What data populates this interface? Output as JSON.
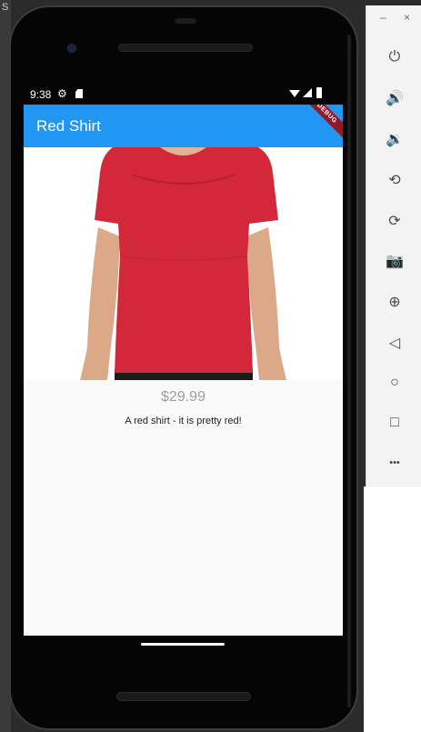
{
  "host": {
    "edge_label": "S"
  },
  "status_bar": {
    "time": "9:38"
  },
  "app": {
    "title": "Red Shirt",
    "debug_banner": "DEBUG",
    "accent": "#2196f3",
    "product": {
      "image_alt": "red-shirt-photo",
      "shirt_color": "#d3283a",
      "price": "$29.99",
      "description": "A red shirt - it is pretty red!"
    }
  },
  "emulator_toolbar": {
    "minimize": "–",
    "close": "×",
    "buttons": [
      {
        "name": "power-icon",
        "glyph": "⏻"
      },
      {
        "name": "volume-up-icon",
        "glyph": "🔊"
      },
      {
        "name": "volume-down-icon",
        "glyph": "🔉"
      },
      {
        "name": "rotate-left-icon",
        "glyph": "⟲"
      },
      {
        "name": "rotate-right-icon",
        "glyph": "⟳"
      },
      {
        "name": "camera-icon",
        "glyph": "📷"
      },
      {
        "name": "zoom-icon",
        "glyph": "⊕"
      },
      {
        "name": "back-icon",
        "glyph": "◁"
      },
      {
        "name": "home-icon",
        "glyph": "○"
      },
      {
        "name": "overview-icon",
        "glyph": "□"
      },
      {
        "name": "more-icon",
        "glyph": "•••"
      }
    ]
  }
}
